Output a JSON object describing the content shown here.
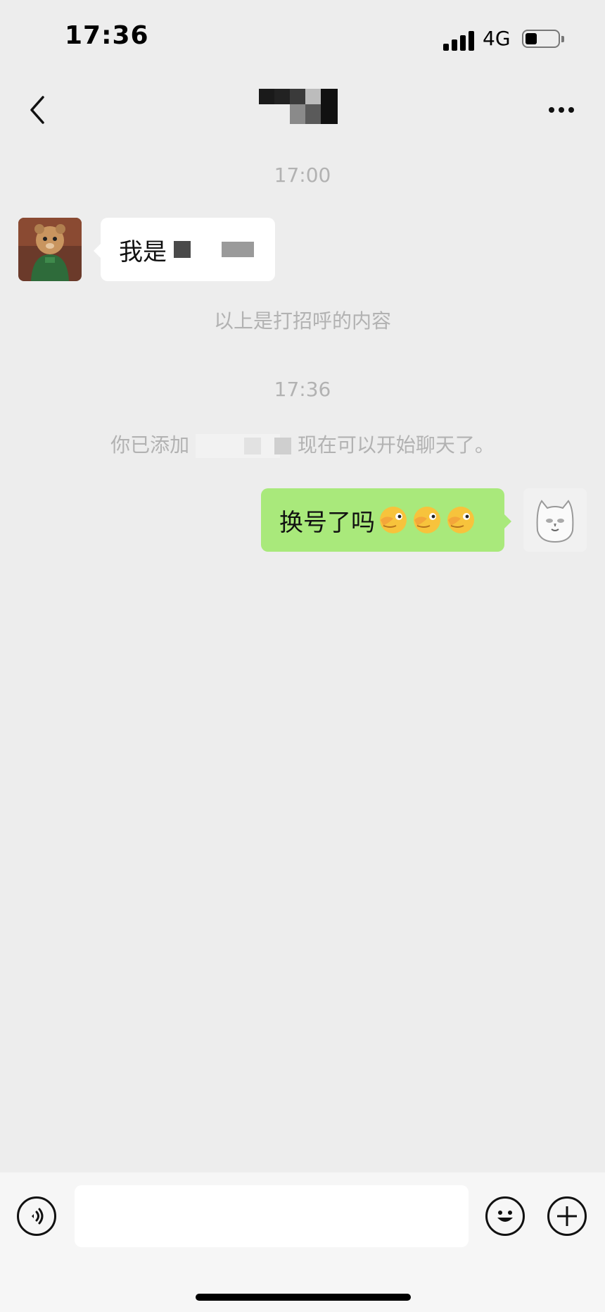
{
  "status_bar": {
    "time": "17:36",
    "network": "4G",
    "battery_level": 0.35
  },
  "header": {
    "title": "",
    "back_icon": "chevron-left-icon",
    "more_icon": "more-dots-icon"
  },
  "messages": {
    "timestamp_1": "17:00",
    "incoming_1": {
      "visible_text": "我是",
      "avatar": "chipmunk-avatar"
    },
    "greeting_note": "以上是打招呼的内容",
    "timestamp_2": "17:36",
    "friend_added_prefix": "你已添加",
    "friend_added_suffix": "现在可以开始聊天了。",
    "outgoing_1": {
      "text": "换号了吗",
      "emoji_count": 3,
      "emoji": "pinching-hand-face-emoji",
      "avatar": "cat-meme-avatar"
    }
  },
  "input_bar": {
    "placeholder": "",
    "voice_icon": "voice-icon",
    "emoji_icon": "smiley-icon",
    "plus_icon": "plus-icon"
  },
  "colors": {
    "background": "#ededed",
    "outgoing_bubble": "#a9e97b",
    "incoming_bubble": "#ffffff",
    "system_text": "#b2b2b2"
  }
}
